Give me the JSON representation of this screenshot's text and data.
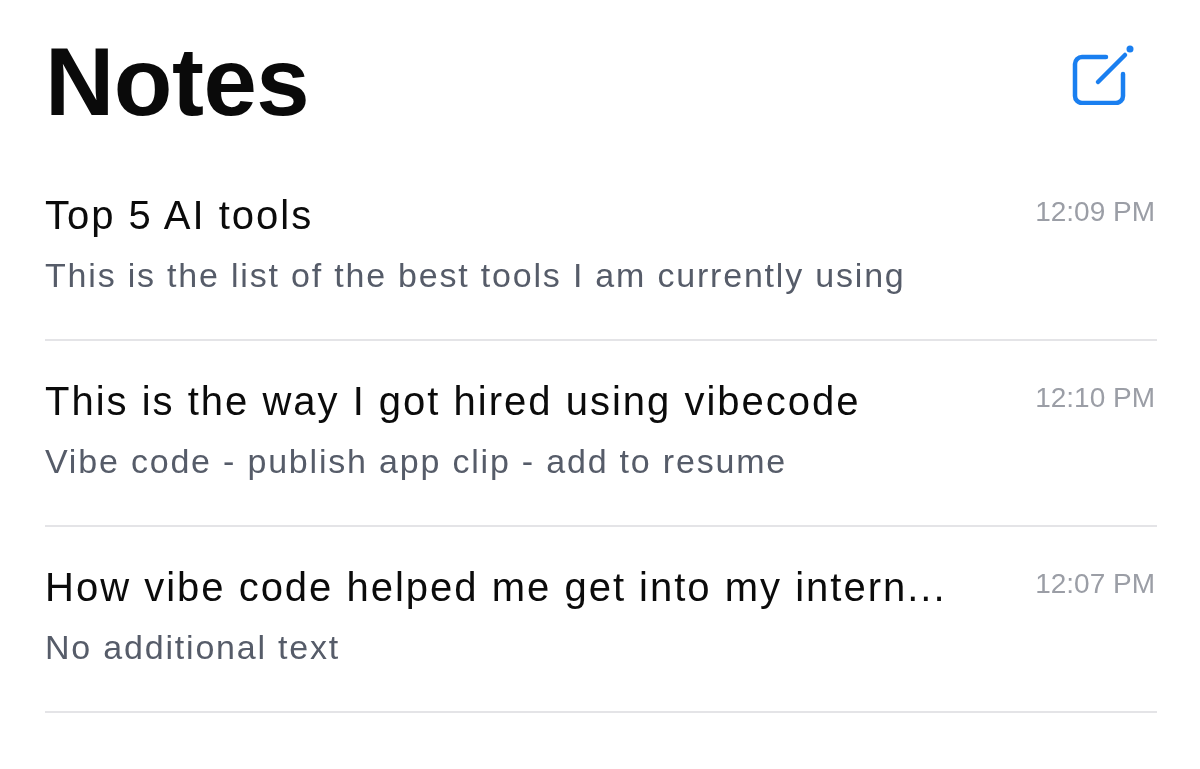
{
  "header": {
    "title": "Notes"
  },
  "notes": [
    {
      "title": "Top 5 AI tools",
      "time": "12:09 PM",
      "preview": "This is the list of the best tools I am currently using"
    },
    {
      "title": "This is the way I got hired using vibecode",
      "time": "12:10 PM",
      "preview": "Vibe code - publish app clip - add to resume"
    },
    {
      "title": "How vibe code helped me get into my intern...",
      "time": "12:07 PM",
      "preview": "No additional text"
    }
  ]
}
